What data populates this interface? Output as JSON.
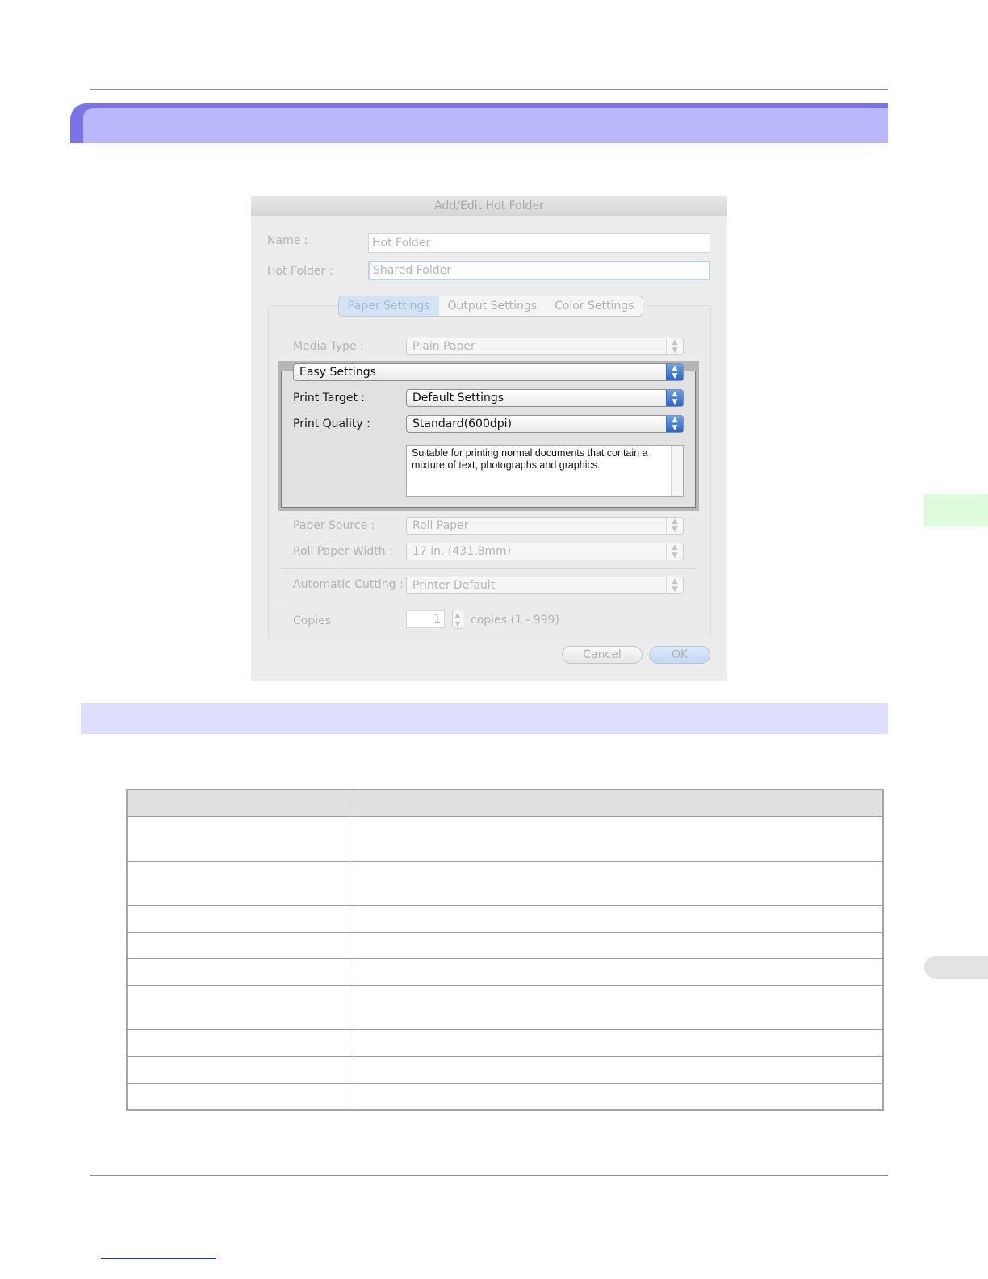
{
  "dialog": {
    "title": "Add/Edit Hot Folder",
    "name_label": "Name :",
    "name_value": "Hot Folder",
    "hotfolder_label": "Hot Folder :",
    "hotfolder_value": "Shared Folder",
    "tabs": [
      "Paper Settings",
      "Output Settings",
      "Color Settings"
    ],
    "selected_tab": "Paper Settings",
    "media_type_label": "Media Type :",
    "media_type_value": "Plain Paper",
    "easy_settings": "Easy Settings",
    "print_target_label": "Print Target :",
    "print_target_value": "Default Settings",
    "print_quality_label": "Print Quality :",
    "print_quality_value": "Standard(600dpi)",
    "description": "Suitable for printing normal documents that contain a mixture of text, photographs and graphics.",
    "paper_source_label": "Paper Source :",
    "paper_source_value": "Roll Paper",
    "roll_width_label": "Roll Paper Width :",
    "roll_width_value": "17 in. (431.8mm)",
    "auto_cut_label": "Automatic Cutting :",
    "auto_cut_value": "Printer Default",
    "copies_label": "Copies",
    "copies_value": "1",
    "copies_range": "copies (1 - 999)",
    "cancel_label": "Cancel",
    "ok_label": "OK"
  },
  "icons": {
    "popup_arrows": "updown-arrows-icon",
    "stepper": "stepper-icon"
  },
  "colors": {
    "heading_accent": "#7a72e8",
    "heading_fill": "#b9b8f9",
    "subheading_fill": "#dfdffd",
    "side_tab": "#dcfcdc"
  }
}
